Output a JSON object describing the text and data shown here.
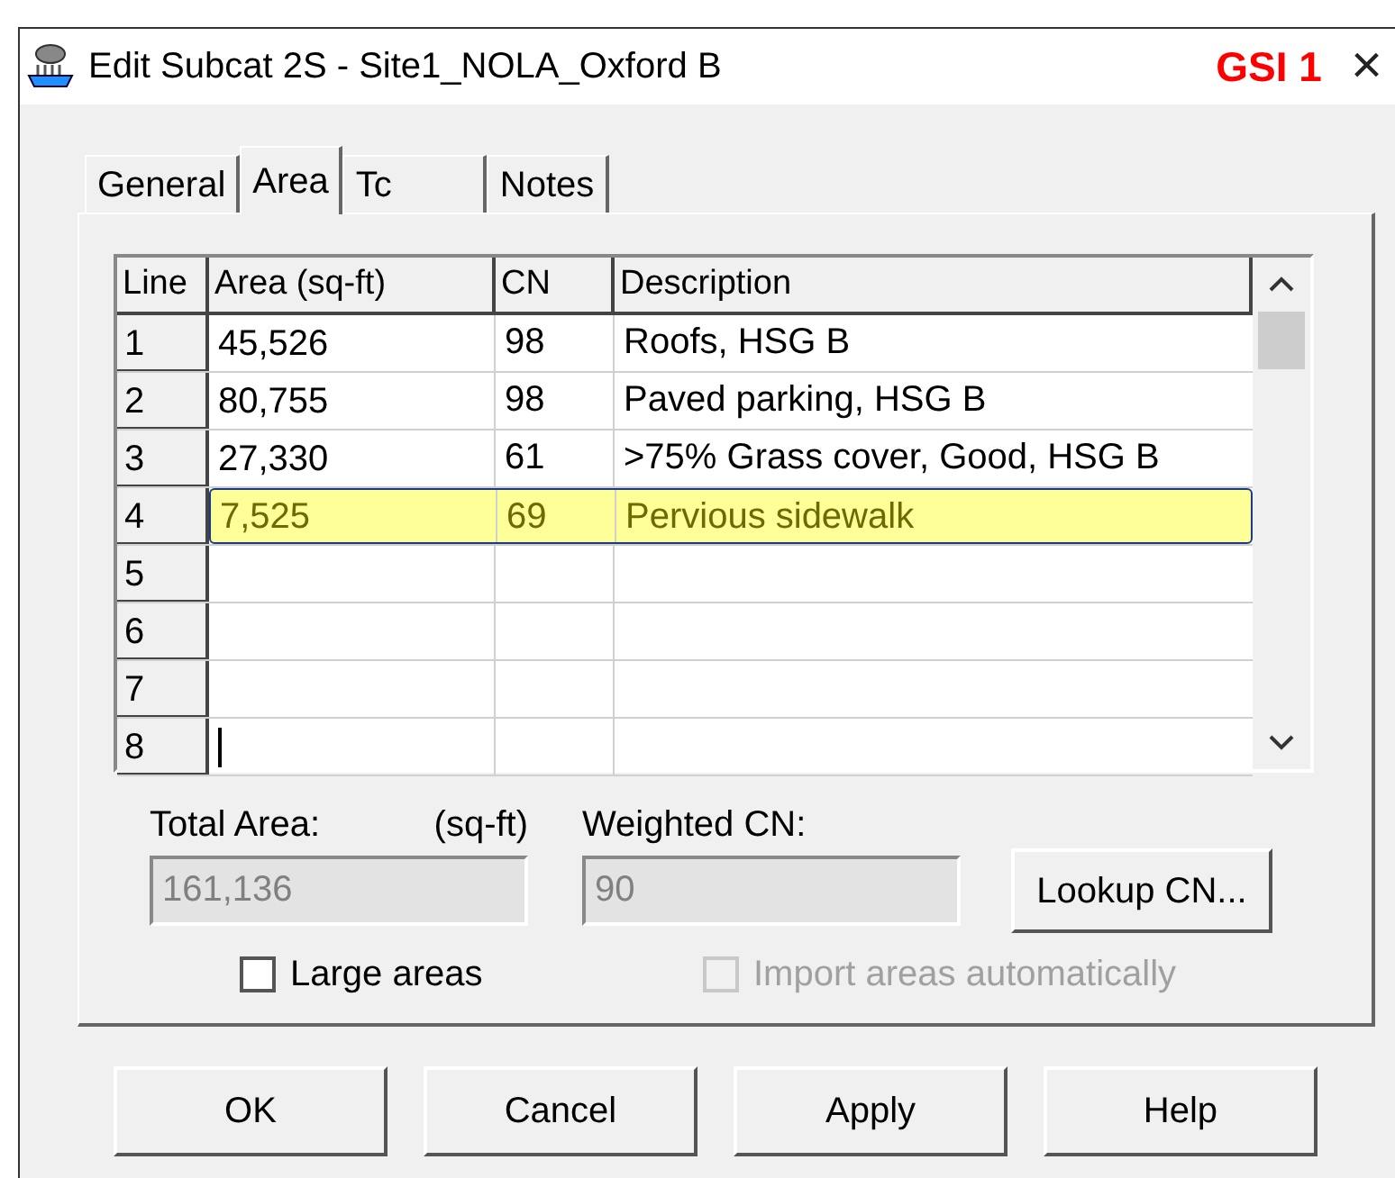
{
  "window": {
    "title": "Edit Subcat 2S - Site1_NOLA_Oxford B",
    "annotation": "GSI 1",
    "close": "×"
  },
  "tabs": [
    {
      "label": "General",
      "selected": false
    },
    {
      "label": "Area",
      "selected": true
    },
    {
      "label": "Tc",
      "selected": false
    },
    {
      "label": "Notes",
      "selected": false
    }
  ],
  "grid": {
    "columns": [
      "Line",
      "Area (sq-ft)",
      "CN",
      "Description"
    ],
    "rows": [
      {
        "line": "1",
        "area": "45,526",
        "cn": "98",
        "description": "Roofs, HSG B",
        "selected": false,
        "editing": false
      },
      {
        "line": "2",
        "area": "80,755",
        "cn": "98",
        "description": "Paved parking, HSG B",
        "selected": false,
        "editing": false
      },
      {
        "line": "3",
        "area": "27,330",
        "cn": "61",
        "description": ">75% Grass cover, Good, HSG B",
        "selected": false,
        "editing": false
      },
      {
        "line": "4",
        "area": "7,525",
        "cn": "69",
        "description": "Pervious sidewalk",
        "selected": true,
        "editing": false
      },
      {
        "line": "5",
        "selected": false,
        "editing": false
      },
      {
        "line": "6",
        "selected": false,
        "editing": false
      },
      {
        "line": "7",
        "selected": false,
        "editing": false
      },
      {
        "line": "8",
        "selected": false,
        "editing": true
      }
    ]
  },
  "totals": {
    "total_area_label": "Total Area:",
    "total_area_unit": "(sq-ft)",
    "total_area": "161,136",
    "weighted_cn_label": "Weighted CN:",
    "weighted_cn": "90",
    "lookup_button": "Lookup CN..."
  },
  "checkboxes": [
    {
      "label": "Large areas",
      "checked": false,
      "disabled": false
    },
    {
      "label": "Import areas automatically",
      "checked": false,
      "disabled": true
    }
  ],
  "buttons": [
    "OK",
    "Cancel",
    "Apply",
    "Help"
  ]
}
